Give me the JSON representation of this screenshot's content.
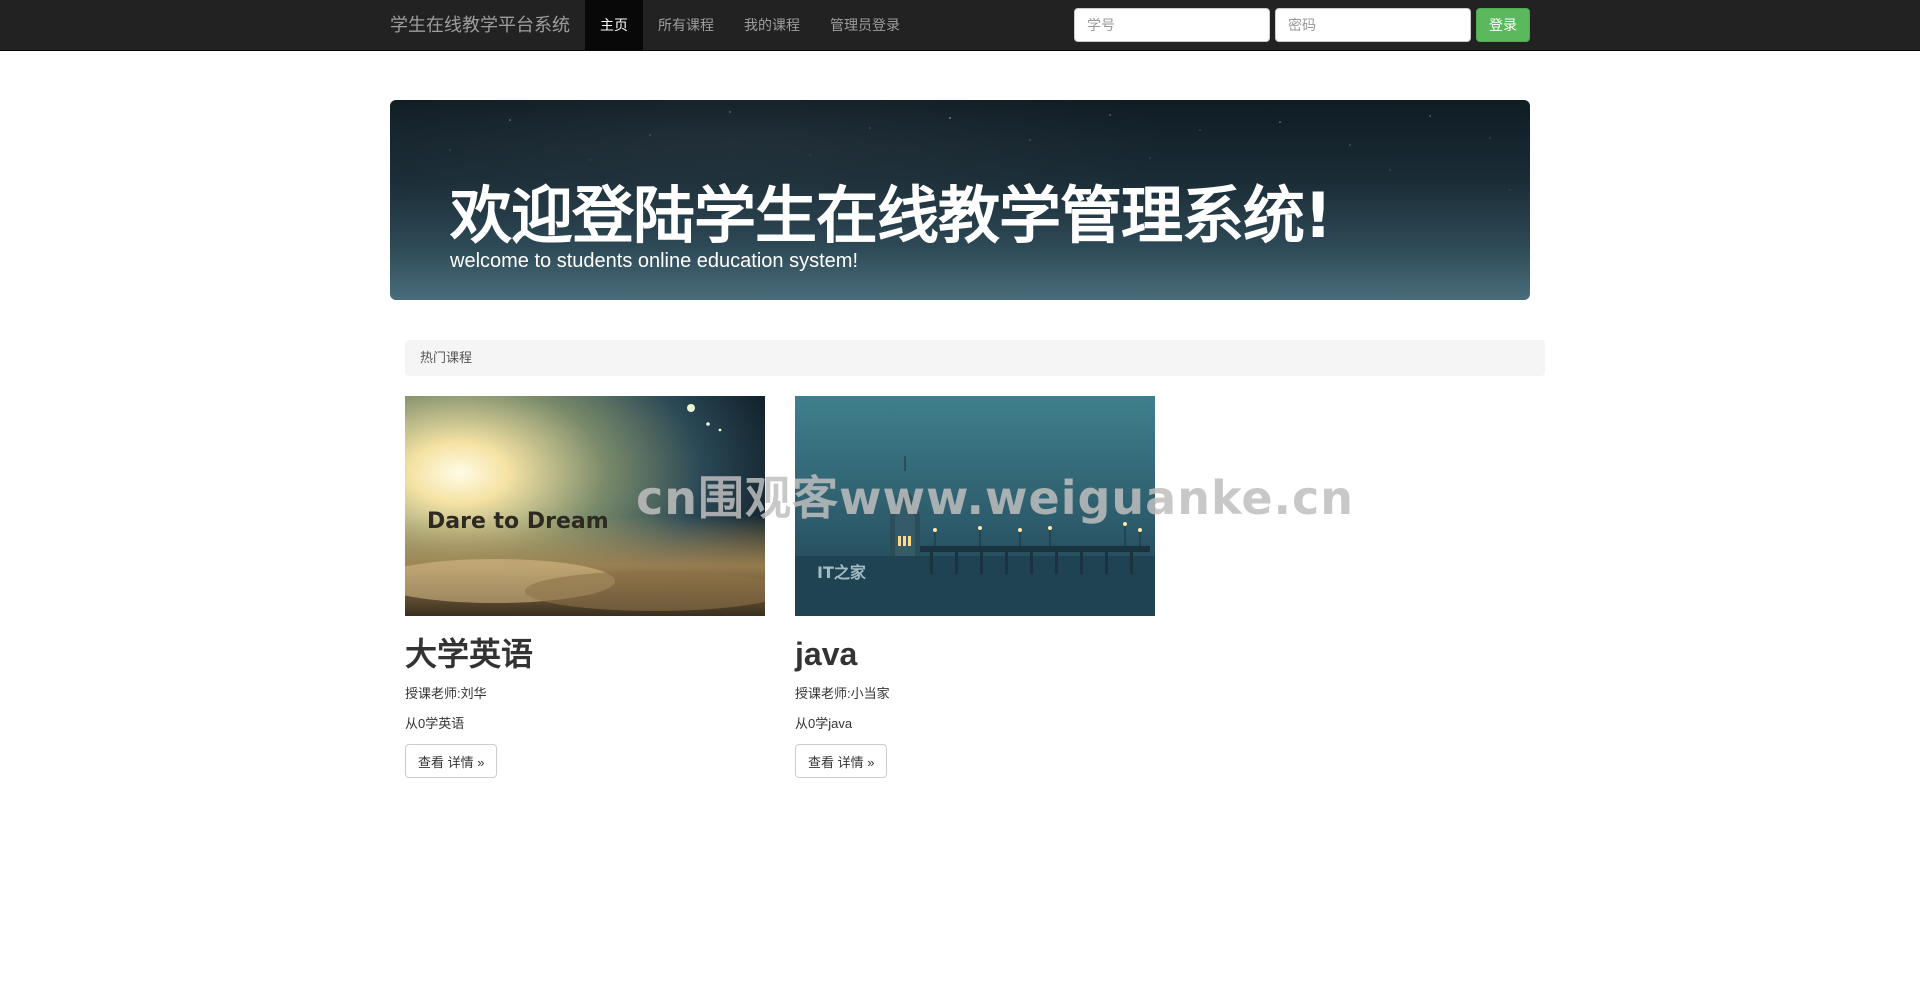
{
  "navbar": {
    "brand": "学生在线教学平台系统",
    "links": [
      {
        "label": "主页",
        "active": true
      },
      {
        "label": "所有课程",
        "active": false
      },
      {
        "label": "我的课程",
        "active": false
      },
      {
        "label": "管理员登录",
        "active": false
      }
    ],
    "login": {
      "student_id_placeholder": "学号",
      "password_placeholder": "密码",
      "submit_label": "登录"
    }
  },
  "hero": {
    "title": "欢迎登陆学生在线教学管理系统!",
    "subtitle": "welcome to students online education system!"
  },
  "section": {
    "title": "热门课程"
  },
  "courses": [
    {
      "image_text": "Dare  to  Dream",
      "name": "大学英语",
      "teacher": "授课老师:刘华",
      "description": "从0学英语",
      "button_label": "查看 详情 »"
    },
    {
      "image_text": "IT之家",
      "name": "java",
      "teacher": "授课老师:小当家",
      "description": "从0学java",
      "button_label": "查看 详情 »"
    }
  ],
  "watermark": "cn围观客www.weiguanke.cn",
  "colors": {
    "navbar_bg": "#222222",
    "nav_active_bg": "#080808",
    "login_button": "#5cb85c",
    "section_header_bg": "#f5f5f5"
  }
}
